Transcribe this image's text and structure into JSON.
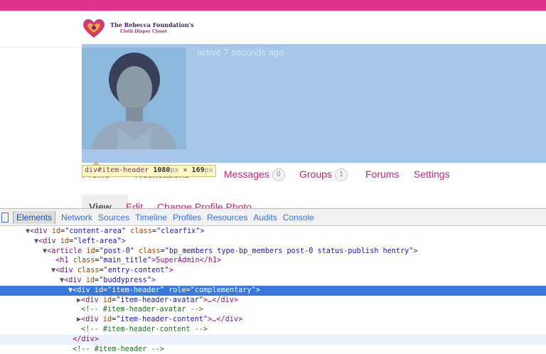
{
  "site": {
    "logo_line1": "The Rebecca Foundation's",
    "logo_line2": "Cloth Diaper Closet"
  },
  "profile": {
    "activity": "active 7 seconds ago"
  },
  "inspector_tooltip": {
    "tag": "div#item-header",
    "width": "1080",
    "unit1": "px",
    "times": " × ",
    "height": "169",
    "unit2": "px"
  },
  "nav": {
    "items": [
      {
        "label": "Profile"
      },
      {
        "label": "Notifications"
      },
      {
        "label": "Messages",
        "count": "0"
      },
      {
        "label": "Groups",
        "count": "1"
      },
      {
        "label": "Forums"
      },
      {
        "label": "Settings"
      }
    ]
  },
  "subnav": {
    "items": [
      {
        "label": "View"
      },
      {
        "label": "Edit"
      },
      {
        "label": "Change Profile Photo"
      }
    ]
  },
  "devtools": {
    "tabs": [
      "Elements",
      "Network",
      "Sources",
      "Timeline",
      "Profiles",
      "Resources",
      "Audits",
      "Console"
    ],
    "active_tab": "Elements",
    "dom_lines": [
      {
        "tri": "▼",
        "open": "<div ",
        "attrs": [
          [
            "id",
            "\"content-area\""
          ],
          [
            "class",
            "\"clearfix\""
          ]
        ],
        "close": ">"
      },
      {
        "tri": "▼",
        "open": "<div ",
        "attrs": [
          [
            "id",
            "\"left-area\""
          ]
        ],
        "close": ">"
      },
      {
        "tri": "▼",
        "open": "<article ",
        "attrs": [
          [
            "id",
            "\"post-0\""
          ],
          [
            "class",
            "\"bp_members type-bp_members post-0 status-publish hentry\""
          ]
        ],
        "close": ">"
      },
      {
        "tri": "",
        "open": "<h1 ",
        "attrs": [
          [
            "class",
            "\"main_title\""
          ]
        ],
        "close": ">SuperAdmin</h1>"
      },
      {
        "tri": "▼",
        "open": "<div ",
        "attrs": [
          [
            "class",
            "\"entry-content\""
          ]
        ],
        "close": ">"
      },
      {
        "tri": "▼",
        "open": "<div ",
        "attrs": [
          [
            "id",
            "\"buddypress\""
          ]
        ],
        "close": ">"
      },
      {
        "tri": "▼",
        "open": "<div ",
        "attrs": [
          [
            "id",
            "\"item-header\""
          ],
          [
            "role",
            "\"complementary\""
          ]
        ],
        "close": ">"
      },
      {
        "tri": "▶",
        "open": "<div ",
        "attrs": [
          [
            "id",
            "\"item-header-avatar\""
          ]
        ],
        "close": ">…</div>"
      },
      {
        "tri": "",
        "comment": "<!-- #item-header-avatar -->"
      },
      {
        "tri": "▶",
        "open": "<div ",
        "attrs": [
          [
            "id",
            "\"item-header-content\""
          ]
        ],
        "close": ">…</div>"
      },
      {
        "tri": "",
        "comment": "<!-- #item-header-content -->"
      },
      {
        "tri": "",
        "open": "</div",
        "attrs": [],
        "close": ">"
      },
      {
        "tri": "",
        "comment": "<!-- #item-header -->"
      }
    ]
  },
  "colors": {
    "brand_pink": "#e0338b",
    "link": "#c2247a",
    "header_highlight": "#a6c6ea",
    "selection": "#3879d9"
  }
}
